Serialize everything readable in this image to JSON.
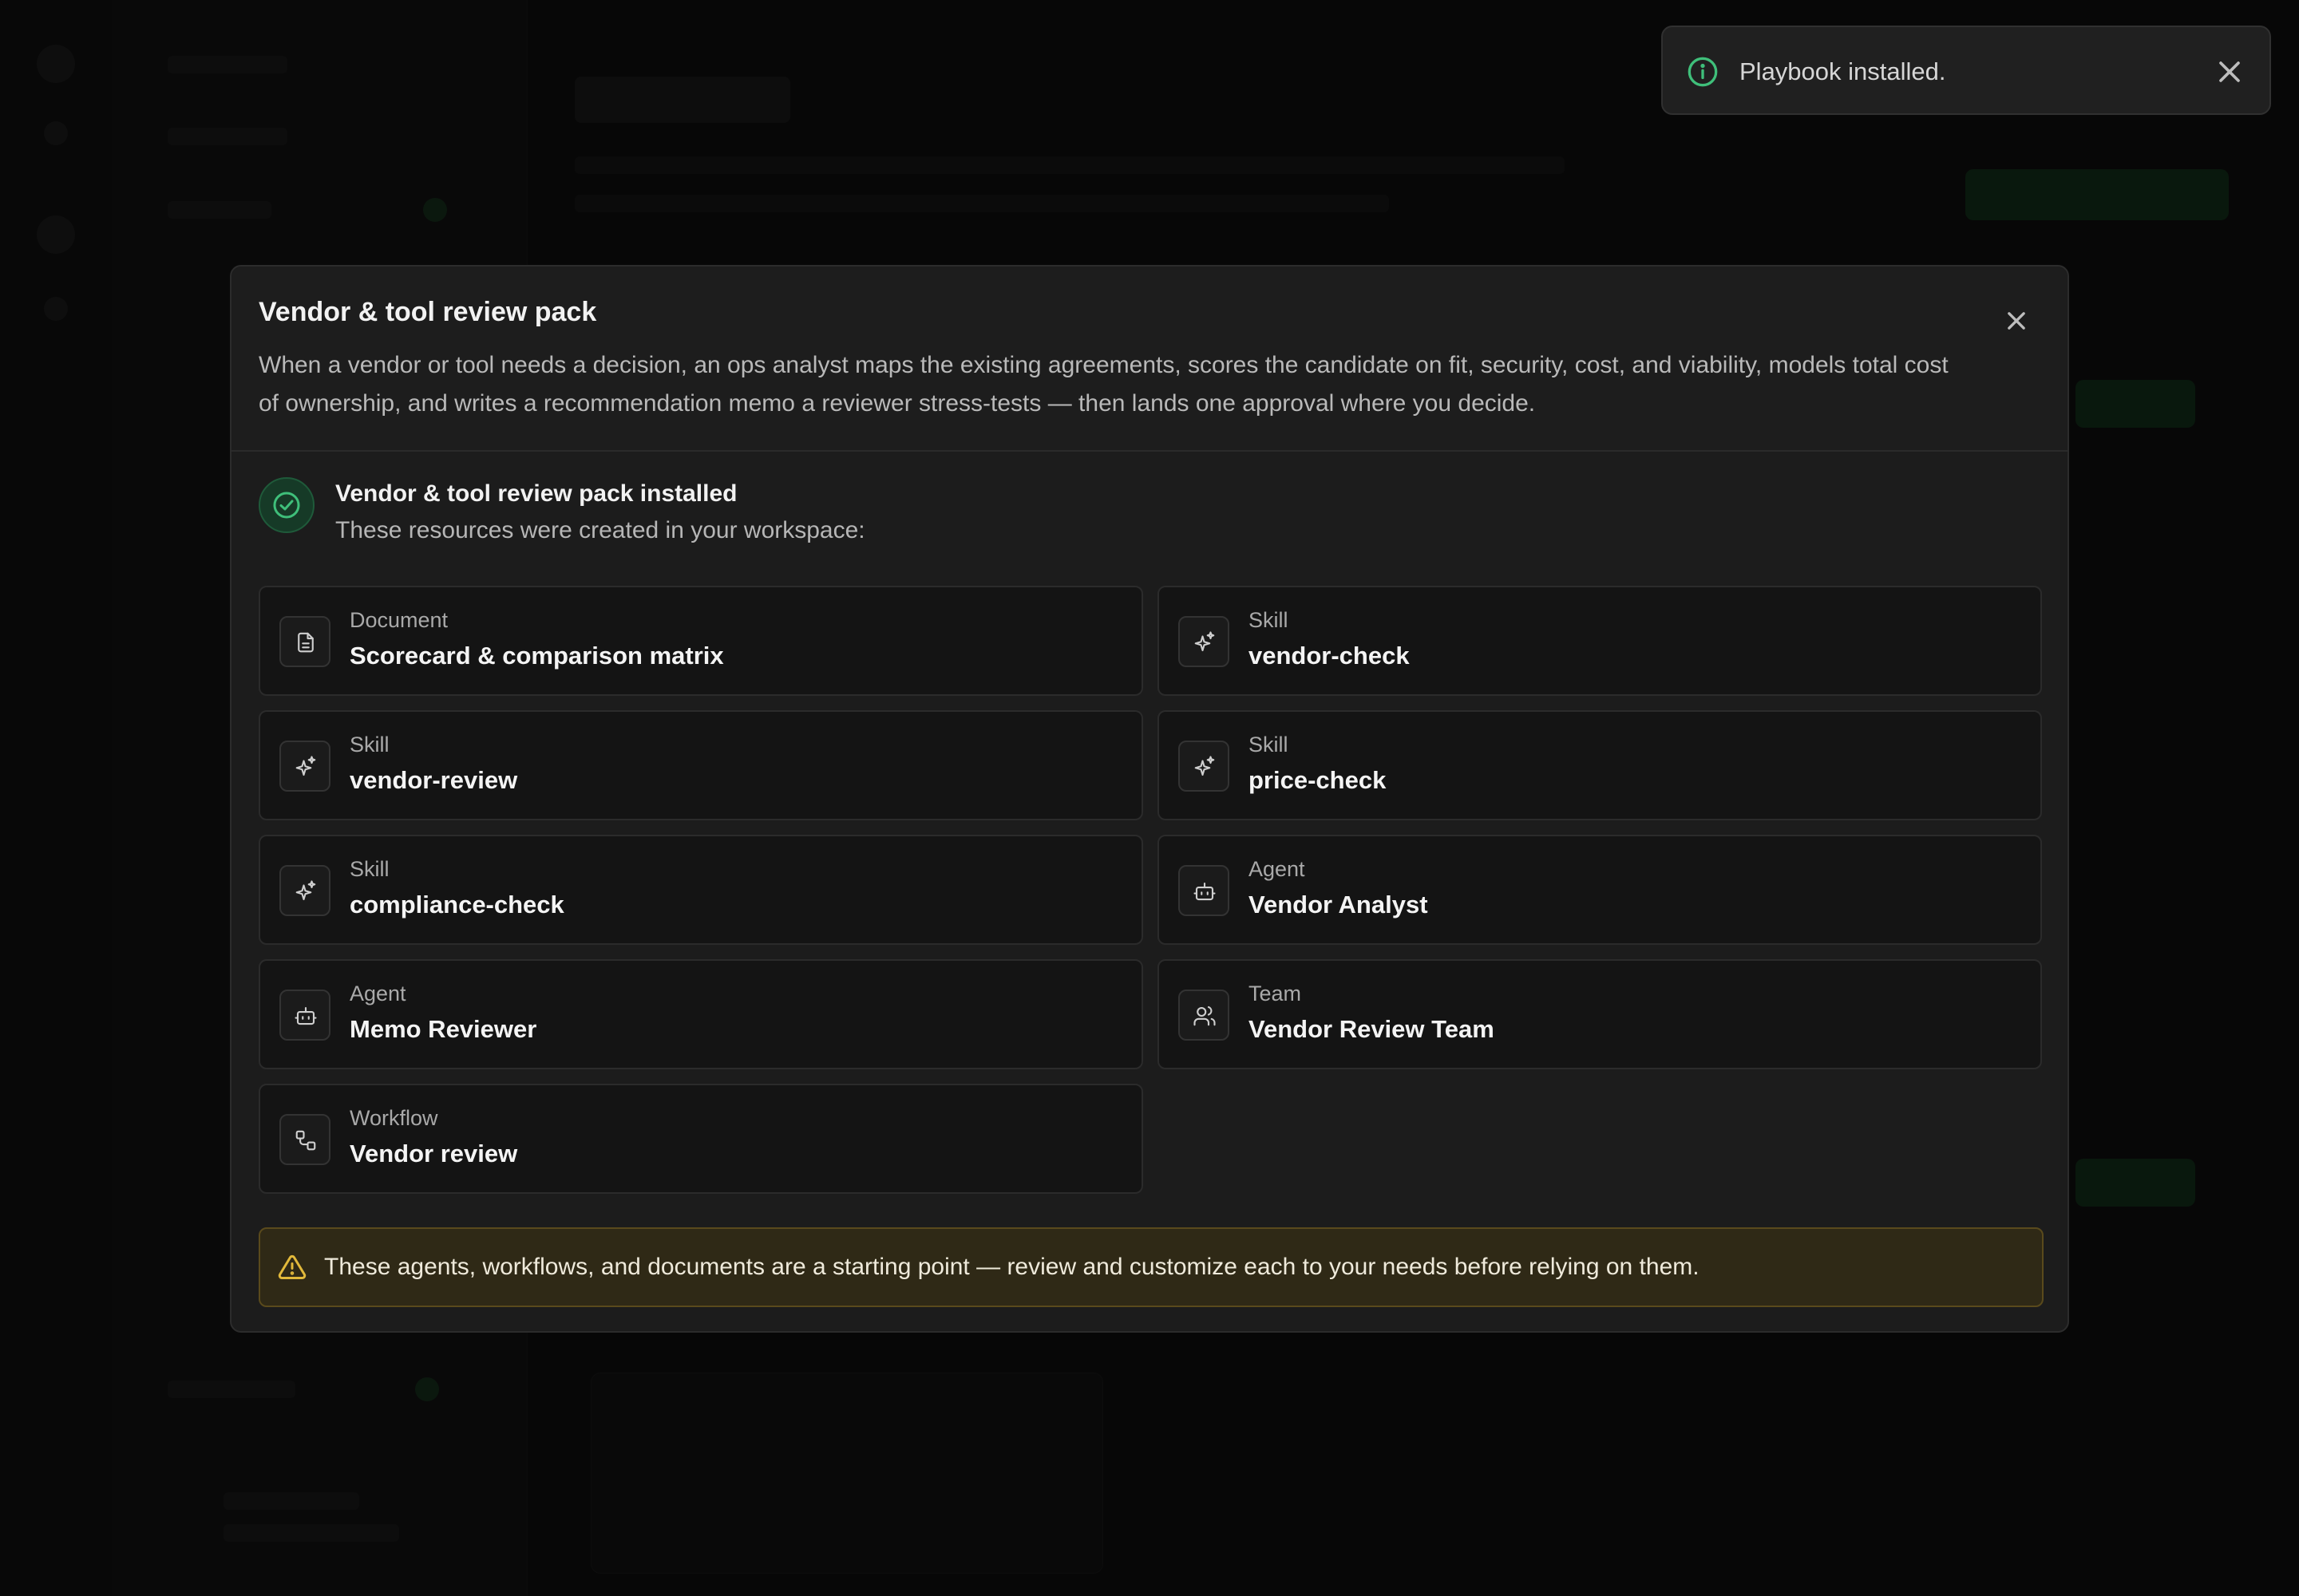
{
  "toast": {
    "icon": "info-icon",
    "message": "Playbook installed.",
    "close_icon": "close-icon"
  },
  "modal": {
    "title": "Vendor & tool review pack",
    "description": "When a vendor or tool needs a decision, an ops analyst maps the existing agreements, scores the candidate on fit, security, cost, and viability, models total cost of ownership, and writes a recommendation memo a reviewer stress-tests — then lands one approval where you decide.",
    "close_icon": "close-icon",
    "installed": {
      "icon": "check-circle-icon",
      "title": "Vendor & tool review pack installed",
      "subtitle": "These resources were created in your workspace:"
    },
    "resources": [
      {
        "kind": "Document",
        "name": "Scorecard & comparison matrix",
        "icon": "document-icon"
      },
      {
        "kind": "Skill",
        "name": "vendor-check",
        "icon": "sparkles-icon"
      },
      {
        "kind": "Skill",
        "name": "vendor-review",
        "icon": "sparkles-icon"
      },
      {
        "kind": "Skill",
        "name": "price-check",
        "icon": "sparkles-icon"
      },
      {
        "kind": "Skill",
        "name": "compliance-check",
        "icon": "sparkles-icon"
      },
      {
        "kind": "Agent",
        "name": "Vendor Analyst",
        "icon": "bot-icon"
      },
      {
        "kind": "Agent",
        "name": "Memo Reviewer",
        "icon": "bot-icon"
      },
      {
        "kind": "Team",
        "name": "Vendor Review Team",
        "icon": "users-icon"
      },
      {
        "kind": "Workflow",
        "name": "Vendor review",
        "icon": "workflow-icon"
      }
    ],
    "warning": {
      "icon": "warning-triangle-icon",
      "text": "These agents, workflows, and documents are a starting point — review and customize each to your needs before relying on them."
    }
  },
  "colors": {
    "background": "#0e0e0e",
    "modal": "#1c1c1c",
    "accent_green": "#3fbf7a",
    "warning_bg": "#2f2916",
    "warning_icon": "#e2b93b"
  }
}
